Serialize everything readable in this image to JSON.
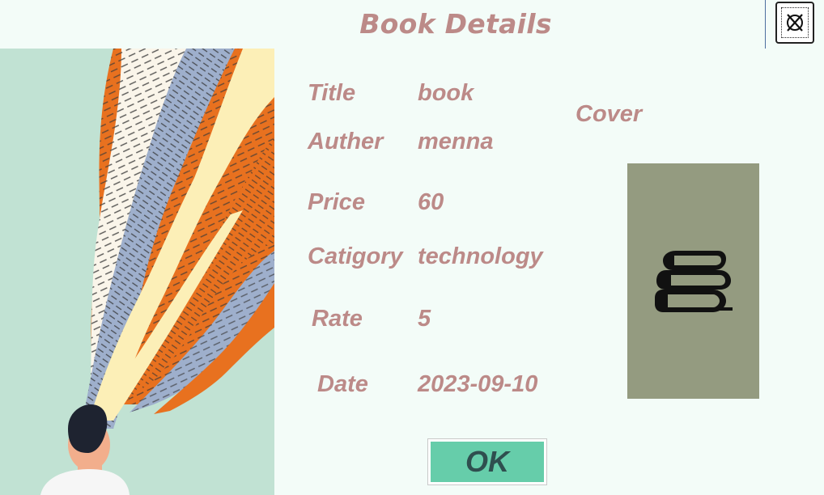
{
  "dialog": {
    "title": "Book Details"
  },
  "fields": {
    "title": {
      "label": "Title",
      "value": "book"
    },
    "author": {
      "label": "Auther",
      "value": "menna"
    },
    "price": {
      "label": "Price",
      "value": "60"
    },
    "category": {
      "label": "Catigory",
      "value": "technology"
    },
    "rate": {
      "label": "Rate",
      "value": "5"
    },
    "date": {
      "label": "Date",
      "value": "2023-09-10"
    }
  },
  "cover": {
    "label": "Cover",
    "icon": "books-stack-icon"
  },
  "buttons": {
    "ok_label": "OK",
    "close_icon": "close-x-icon"
  },
  "illustration": {
    "icon": "person-with-flowing-book-pages-illustration"
  },
  "colors": {
    "background": "#F3FCF8",
    "label_text": "#BC8A88",
    "cover_bg": "#949B80",
    "ok_button_bg": "#66CDAA",
    "ok_button_text": "#2F4F4F",
    "illustration_bg": "#C1E2D3"
  }
}
